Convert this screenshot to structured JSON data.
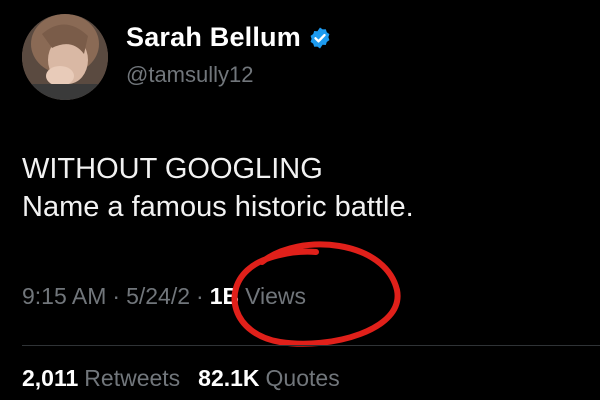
{
  "author": {
    "display_name": "Sarah Bellum",
    "handle": "@tamsully12",
    "verified": true
  },
  "tweet": {
    "lines": [
      "WITHOUT GOOGLING",
      "Name a famous historic battle."
    ],
    "time": "9:15 AM",
    "date": "5/24/2",
    "separator": "·",
    "views_count": "1B",
    "views_label": "Views"
  },
  "stats": {
    "retweets_count": "2,011",
    "retweets_label": "Retweets",
    "quotes_count": "82.1K",
    "quotes_label": "Quotes"
  },
  "colors": {
    "background": "#000000",
    "secondary_text": "#71767b",
    "verified_badge": "#1d9bf0",
    "annotation_circle": "#e0201a"
  }
}
